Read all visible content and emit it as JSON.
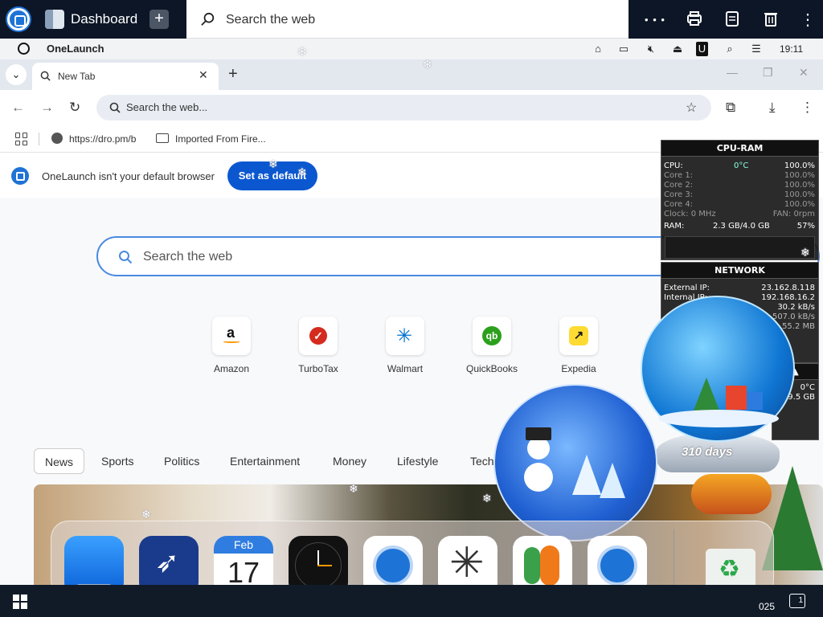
{
  "launcher": {
    "tab_label": "Dashboard",
    "add_label": "+",
    "search_placeholder": "Search the web",
    "more_label": "• • •"
  },
  "system_bar": {
    "title": "OneLaunch",
    "time": "19:11",
    "u_label": "U"
  },
  "browser": {
    "tab_title": "New Tab",
    "tab_close": "✕",
    "new_tab": "+",
    "omnibox_placeholder": "Search the web...",
    "bookmarks": [
      {
        "label": "https://dro.pm/b"
      },
      {
        "label": "Imported From Fire..."
      }
    ]
  },
  "banner": {
    "text": "OneLaunch isn't your default browser",
    "button": "Set as default"
  },
  "page": {
    "search_placeholder": "Search the web",
    "shortcuts": [
      {
        "label": "Amazon",
        "icon": "amazon-icon"
      },
      {
        "label": "TurboTax",
        "icon": "turbotax-icon"
      },
      {
        "label": "Walmart",
        "icon": "walmart-icon"
      },
      {
        "label": "QuickBooks",
        "icon": "quickbooks-icon"
      },
      {
        "label": "Expedia",
        "icon": "expedia-icon"
      }
    ],
    "news_tabs": [
      "News",
      "Sports",
      "Politics",
      "Entertainment",
      "Money",
      "Lifestyle",
      "Tech"
    ]
  },
  "cpu_widget": {
    "title": "CPU-RAM",
    "cpu_label": "CPU:",
    "cpu_temp": "0°C",
    "cpu_pct": "100.0%",
    "cores": [
      {
        "label": "Core 1:",
        "value": "100.0%"
      },
      {
        "label": "Core 2:",
        "value": "100.0%"
      },
      {
        "label": "Core 3:",
        "value": "100.0%"
      },
      {
        "label": "Core 4:",
        "value": "100.0%"
      }
    ],
    "clock": "Clock: 0 MHz",
    "fan": "FAN: 0rpm",
    "ram_label": "RAM:",
    "ram_value": "2.3 GB/4.0 GB",
    "ram_pct": "57%"
  },
  "net_widget": {
    "title": "NETWORK",
    "external_label": "External IP:",
    "external_ip": "23.162.8.118",
    "internal_label": "Internal IP:",
    "internal_ip": "192.168.16.2",
    "up_rate": "30.2 kB/s",
    "down_rate": "507.0 kB/s",
    "total": "55.2 MB"
  },
  "mini_widget": {
    "temp": "0°C",
    "value": "9.5 GB"
  },
  "snow_globe": {
    "days_text": "310 days"
  },
  "dock": {
    "calendar_month": "Feb",
    "calendar_day": "17",
    "apps": [
      "finder-icon",
      "rocket-launcher-icon",
      "calendar-icon",
      "clock-icon",
      "onelaunch-icon",
      "asterisk-app-icon",
      "messenger-icon",
      "onelaunch-icon",
      "recycle-bin-icon"
    ]
  },
  "taskbar": {
    "time_partial": "025",
    "notification_count": "1"
  },
  "colors": {
    "accent": "#0b57d0",
    "launcher_bg": "#0d1626",
    "taskbar_bg": "#111b28"
  }
}
